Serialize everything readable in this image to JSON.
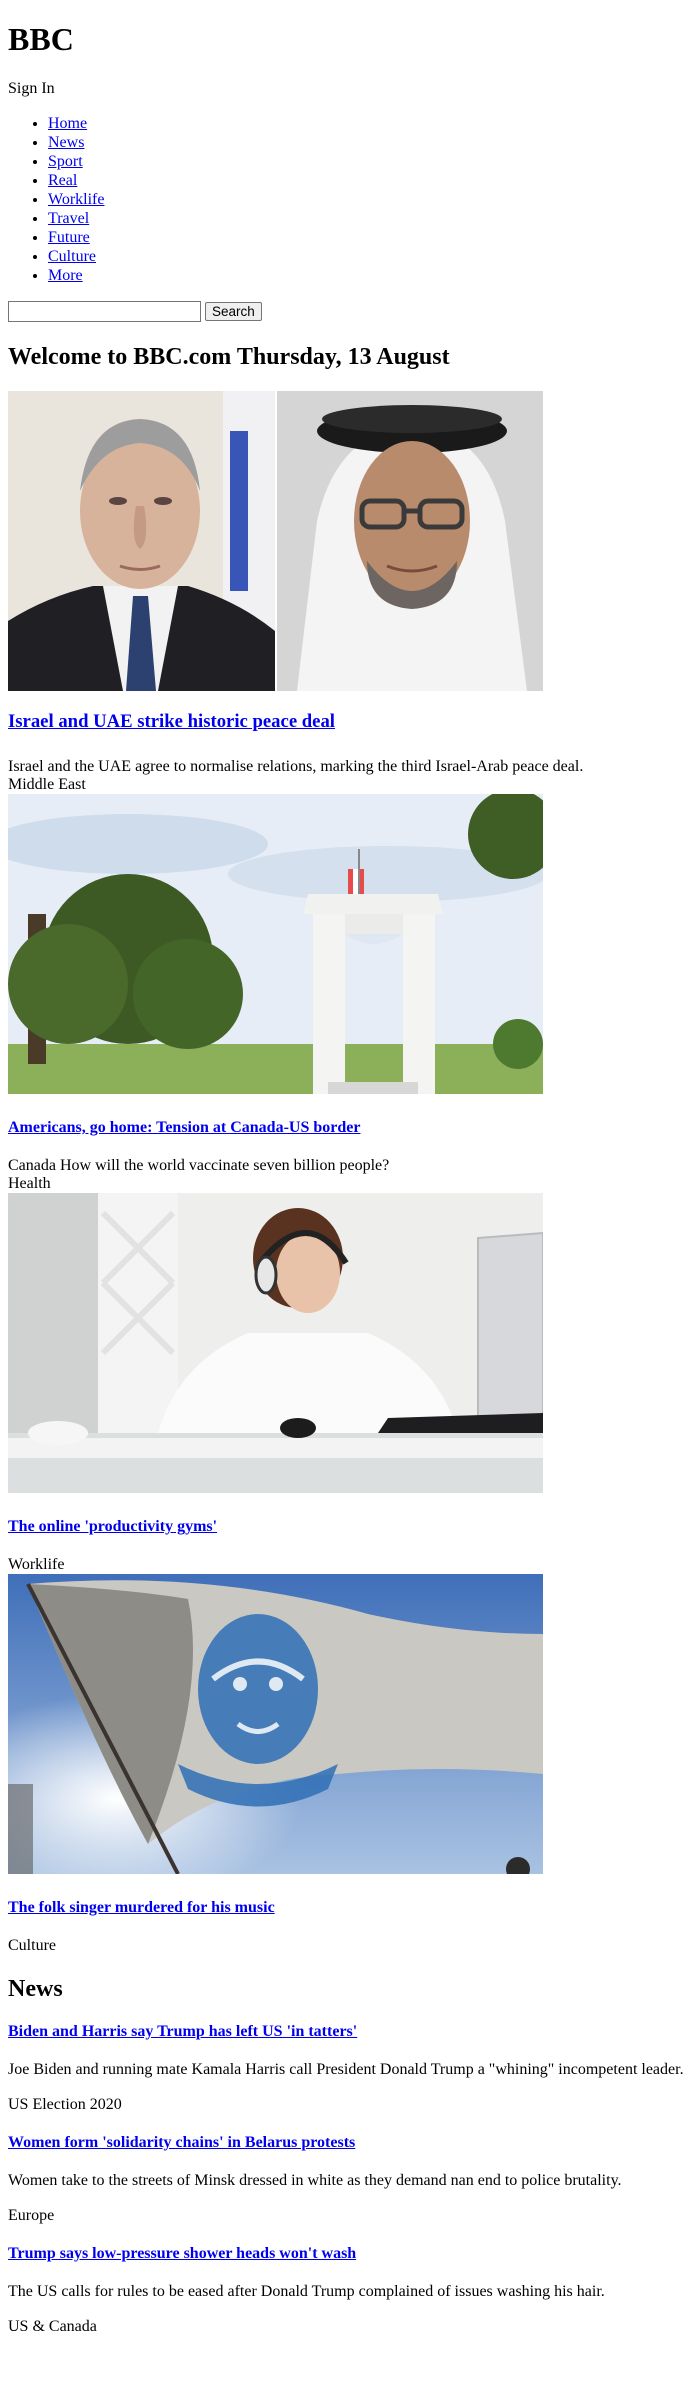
{
  "header": {
    "logo": "BBC",
    "sign_in": "Sign In"
  },
  "nav": {
    "items": [
      "Home",
      "News",
      "Sport",
      "Real",
      "Worklife",
      "Travel",
      "Future",
      "Culture",
      "More"
    ]
  },
  "search": {
    "value": "",
    "placeholder": "",
    "button_label": "Search"
  },
  "welcome": {
    "title": "Welcome to BBC.com Thursday, 13 August"
  },
  "hero": {
    "headline": "Israel and UAE strike historic peace deal",
    "summary": "Israel and the UAE agree to normalise relations, marking the third Israel-Arab peace deal.",
    "tag": "Middle East"
  },
  "stories": [
    {
      "headline": "Americans, go home: Tension at Canada-US border",
      "summary": "Canada How will the world vaccinate seven billion people?",
      "tag": "Health"
    },
    {
      "headline": "The online 'productivity gyms'",
      "summary": "",
      "tag": "Worklife"
    },
    {
      "headline": "The folk singer murdered for his music",
      "summary": "",
      "tag": "Culture"
    }
  ],
  "news": {
    "heading": "News",
    "items": [
      {
        "headline": "Biden and Harris say Trump has left US 'in tatters'",
        "summary": "Joe Biden and running mate Kamala Harris call President Donald Trump a \"whining\" incompetent leader.",
        "tag": "US Election 2020"
      },
      {
        "headline": "Women form 'solidarity chains' in Belarus protests",
        "summary": "Women take to the streets of Minsk dressed in white as they demand nan end to police brutality.",
        "tag": "Europe"
      },
      {
        "headline": "Trump says low-pressure shower heads won't wash",
        "summary": "The US calls for rules to be eased after Donald Trump complained of issues washing his hair.",
        "tag": "US & Canada"
      }
    ]
  }
}
